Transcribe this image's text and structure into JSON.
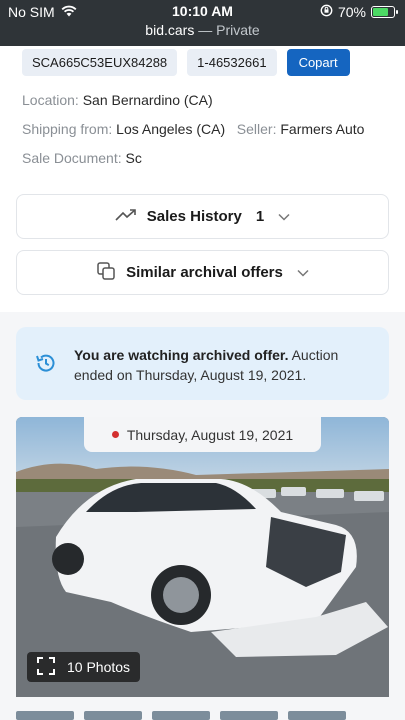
{
  "status_bar": {
    "carrier": "No SIM",
    "time": "10:10 AM",
    "battery": "70%"
  },
  "address_bar": {
    "domain": "bid.cars",
    "mode": "— Private"
  },
  "lot": {
    "vin": "SCA665C53EUX84288",
    "lot_number": "1-46532661",
    "auction": "Copart"
  },
  "details": {
    "location_label": "Location:",
    "location_value": "San Bernardino (CA)",
    "shipping_label": "Shipping from:",
    "shipping_value": "Los Angeles (CA)",
    "seller_label": "Seller:",
    "seller_value": "Farmers Auto",
    "sale_doc_label": "Sale Document:",
    "sale_doc_value": "Sc"
  },
  "sales_history": {
    "label": "Sales History",
    "count": "1"
  },
  "similar": {
    "label": "Similar archival offers"
  },
  "notice": {
    "bold": "You are watching archived offer.",
    "rest": " Auction ended on Thursday, August 19, 2021."
  },
  "photo": {
    "date": "Thursday, August 19, 2021",
    "photos_label": "10 Photos"
  },
  "colors": {
    "accent": "#1565c0",
    "notice_bg": "#e3f0fb",
    "live_dot": "#d32f2f"
  },
  "icons": [
    "wifi-icon",
    "rotation-lock-icon",
    "battery-icon",
    "trend-up-icon",
    "chevron-down-icon",
    "copy-icon",
    "history-icon",
    "expand-icon"
  ]
}
